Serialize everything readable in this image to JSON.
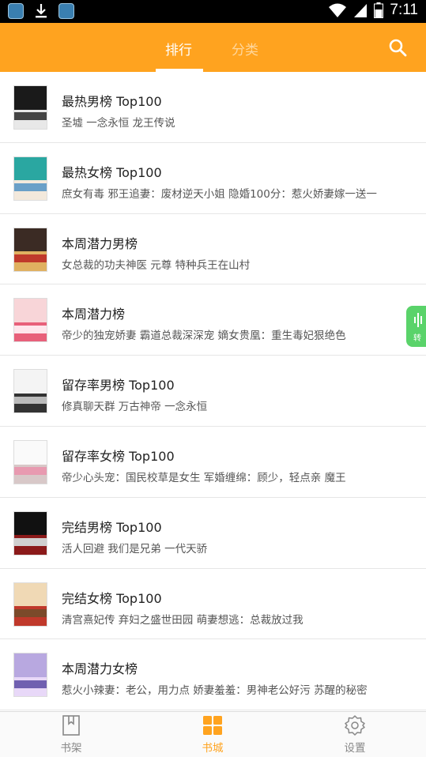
{
  "status_bar": {
    "time": "7:11",
    "left_icons": [
      "app-icon",
      "download-icon",
      "app-icon"
    ],
    "right_icons": [
      "wifi-icon",
      "signal-icon",
      "battery-icon"
    ]
  },
  "header": {
    "tabs": [
      {
        "label": "排行",
        "active": true
      },
      {
        "label": "分类",
        "active": false
      }
    ],
    "search_icon": "search-icon",
    "bg_color": "#ffa31f"
  },
  "ranking_list": [
    {
      "title": "最热男榜 Top100",
      "books": "圣墟 一念永恒 龙王传说",
      "cover_colors": [
        "#1a1a1a",
        "#e8e8e8",
        "#444444"
      ]
    },
    {
      "title": "最热女榜 Top100",
      "books": "庶女有毒 邪王追妻：废材逆天小姐 隐婚100分：惹火娇妻嫁一送一",
      "cover_colors": [
        "#2aa7a1",
        "#f3e9dc",
        "#6aa0c8"
      ]
    },
    {
      "title": "本周潜力男榜",
      "books": "女总裁的功夫神医 元尊 特种兵王在山村",
      "cover_colors": [
        "#3b2b24",
        "#e0b060",
        "#c0392b"
      ]
    },
    {
      "title": "本周潜力榜",
      "books": "帝少的独宠娇妻 霸道总裁深深宠 嫡女贵凰：重生毒妃狠绝色",
      "cover_colors": [
        "#f8d5d8",
        "#e8607a",
        "#ffe6ec"
      ]
    },
    {
      "title": "留存率男榜 Top100",
      "books": "修真聊天群 万古神帝 一念永恒",
      "cover_colors": [
        "#f4f4f4",
        "#333333",
        "#bbbbbb"
      ]
    },
    {
      "title": "留存率女榜 Top100",
      "books": "帝少心头宠：国民校草是女生 军婚缠绵：顾少，轻点亲 魔王",
      "cover_colors": [
        "#fafafa",
        "#d8c8c8",
        "#e89ab0"
      ]
    },
    {
      "title": "完结男榜 Top100",
      "books": "活人回避 我们是兄弟 一代天骄",
      "cover_colors": [
        "#111111",
        "#8b1a1a",
        "#d0d0d0"
      ]
    },
    {
      "title": "完结女榜 Top100",
      "books": "清宫熹妃传 弃妇之盛世田园 萌妻想逃：总裁放过我",
      "cover_colors": [
        "#f0d9b5",
        "#c0392b",
        "#7b4a2a"
      ]
    },
    {
      "title": "本周潜力女榜",
      "books": "惹火小辣妻：老公，用力点 娇妻羞羞：男神老公好污 苏醒的秘密",
      "cover_colors": [
        "#b8a8e0",
        "#e8d8f8",
        "#7060b0"
      ]
    }
  ],
  "float_button": {
    "label": "转",
    "icon": "voice-wave-icon",
    "color": "#5ad36a"
  },
  "bottom_nav": [
    {
      "label": "书架",
      "icon": "bookmark-icon",
      "active": false
    },
    {
      "label": "书城",
      "icon": "grid-icon",
      "active": true
    },
    {
      "label": "设置",
      "icon": "gear-icon",
      "active": false
    }
  ]
}
